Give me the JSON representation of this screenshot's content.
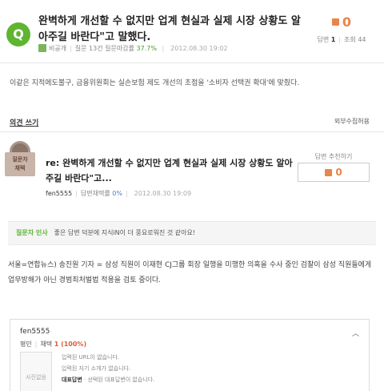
{
  "question": {
    "badge": "Q",
    "title": "완벽하게 개선할 수 없지만 업계 현실과 실제 시장 상황도 알아주길 바란다\"고 말했다.",
    "author": "비공개",
    "stats": "질문 13건 질문마감률",
    "close_rate": "37.7%",
    "date": "2012.08.30 19:02",
    "body": "이같은 지적에도불구, 금융위원회는 실손보험 제도 개선의 초점을 '소비자 선택권 확대'에 맞췄다."
  },
  "votes": {
    "count": "0",
    "answers_label": "답변",
    "answers": "1",
    "views_label": "조회",
    "views": "44"
  },
  "toolbar": {
    "opinion_link": "의견 쓰기",
    "external_label": "외부수집허용"
  },
  "answer": {
    "medal_line1": "질문자",
    "medal_line2": "채택",
    "title": "re: 완벽하게 개선할 수 없지만 업계 현실과 실제 시장 상황도 알아주길 바란다\"고...",
    "author": "fen5555",
    "adopt_label": "답변채택률",
    "adopt_rate": "0%",
    "date": "2012.08.30 19:09",
    "recommend_label": "답변 추천하기",
    "recommend_count": "0",
    "greeting_label": "질문자 인사",
    "greeting_text": "좋은 답변 덕분에 지식iN이 더 풍요로워진 것 같아요!",
    "body": "서울=연합뉴스) 송진원 기자 = 삼성 직원이 이재현 CJ그룹 회장 일행을 미행한 의혹을 수사 중인 검찰이 삼성 직원들에게 업무방해가 아닌 경범죄처벌법 적용을 검토 중이다."
  },
  "profile": {
    "name": "fen5555",
    "rank": "평민",
    "adopt_prefix": "채택",
    "adopt_value": "1 (100%)",
    "photo_label": "사진없음",
    "url_text": "입력된 URL이 없습니다.",
    "intro_text": "입력된 자기 소개가 없습니다.",
    "rep_label": "대표답변",
    "rep_text": "· 선택된 대표답변이 없습니다."
  },
  "colors": {
    "green": "#5fb432",
    "orange": "#e8864a"
  }
}
